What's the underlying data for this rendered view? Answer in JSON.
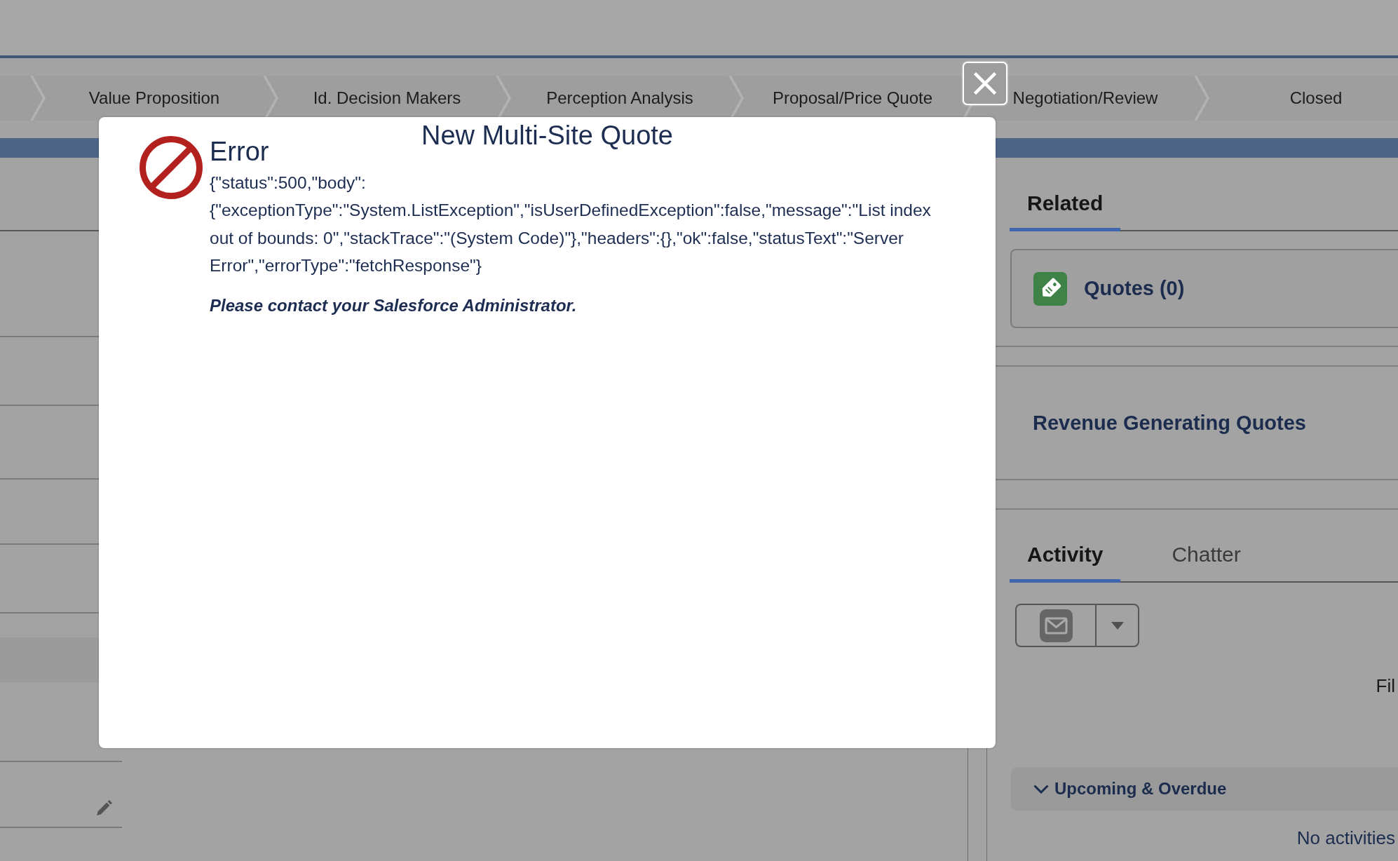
{
  "path": {
    "stages": [
      "Value Proposition",
      "Id. Decision Makers",
      "Perception Analysis",
      "Proposal/Price Quote",
      "Negotiation/Review",
      "Closed"
    ]
  },
  "modal": {
    "title": "New Multi-Site Quote",
    "error": {
      "heading": "Error",
      "details": "{\"status\":500,\"body\":{\"exceptionType\":\"System.ListException\",\"isUserDefinedException\":false,\"message\":\"List index out of bounds: 0\",\"stackTrace\":\"(System Code)\"},\"headers\":{},\"ok\":false,\"statusText\":\"Server Error\",\"errorType\":\"fetchResponse\"}",
      "advice": "Please contact your Salesforce Administrator."
    }
  },
  "related_panel": {
    "tabs": [
      {
        "label": "Related",
        "selected": true
      }
    ],
    "quotes_card": {
      "title": "Quotes (0)"
    },
    "revenue_card": {
      "title": "Revenue Generating Quotes"
    }
  },
  "activity_panel": {
    "tabs": [
      {
        "label": "Activity",
        "selected": true
      },
      {
        "label": "Chatter",
        "selected": false
      }
    ],
    "filter_label": "Fil",
    "sections": [
      {
        "title": "Upcoming & Overdue",
        "expanded": true
      }
    ],
    "empty_message": "No activities"
  }
}
